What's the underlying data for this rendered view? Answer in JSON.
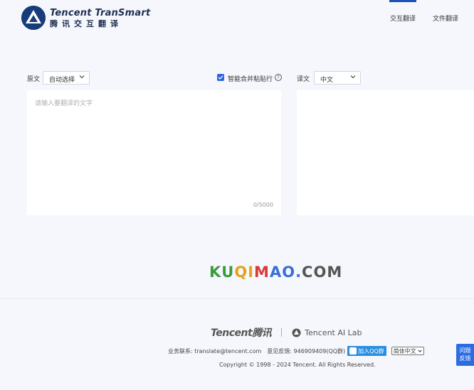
{
  "header": {
    "logo_en": "Tencent TranSmart",
    "logo_cn": "腾讯交互翻译",
    "tabs": [
      {
        "label": "交互翻译",
        "active": true
      },
      {
        "label": "文件翻译",
        "active": false
      }
    ]
  },
  "toolbar": {
    "source_label": "原文",
    "source_lang": "自动选择",
    "merge_paste_label": "智能合并粘贴行",
    "merge_paste_checked": true,
    "target_label": "译文",
    "target_lang": "中文"
  },
  "source": {
    "placeholder": "请输入要翻译的文字",
    "value": "",
    "char_count": "0/5000"
  },
  "watermark": {
    "text": "KUQIMAO.COM",
    "colors": [
      "#3a9b3e",
      "#3a9b3e",
      "#e6a11a",
      "#e6a11a",
      "#d63b3b",
      "#3a6fd6",
      "#3a6fd6",
      "#3a6fd6",
      "#555555",
      "#555555",
      "#555555"
    ]
  },
  "footer": {
    "tencent_logo": "Tencent腾讯",
    "ailab": "Tencent AI Lab",
    "business": "业务联系: translate@tencent.com",
    "feedback_qq": "意见反馈: 946909409(QQ群)",
    "join_qq": "加入QQ群",
    "ui_lang": "简体中文",
    "copyright": "Copyright © 1998 - 2024 Tencent. All Rights Reserved."
  },
  "feedback_button": {
    "line1": "问题",
    "line2": "反馈"
  },
  "colors": {
    "accent": "#1f4fb9",
    "background": "#f5f7fc",
    "feedback": "#2b6de0"
  }
}
